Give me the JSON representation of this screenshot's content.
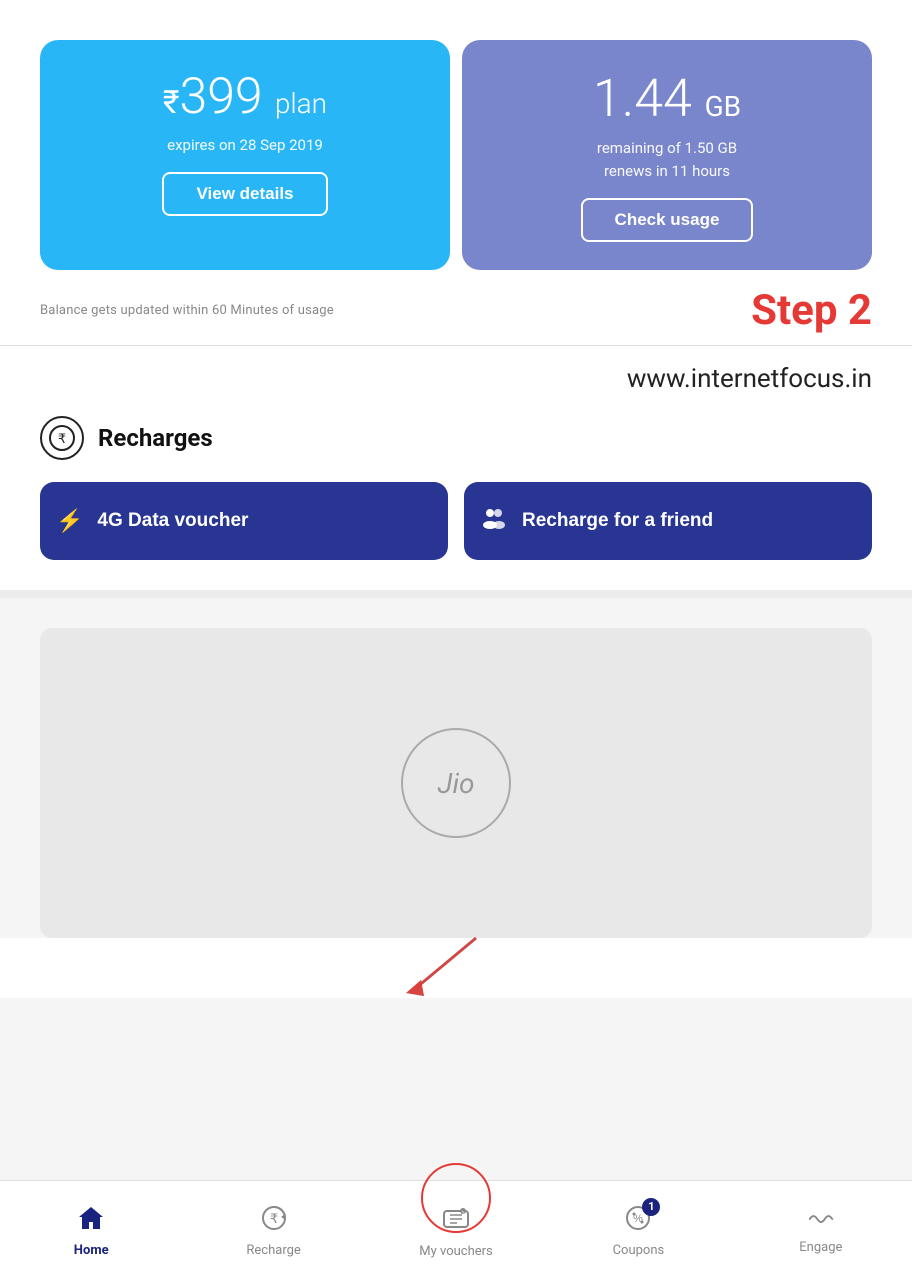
{
  "plan_card": {
    "rupee": "₹",
    "amount": "399",
    "plan_word": "plan",
    "expires": "expires on 28 Sep 2019",
    "btn_label": "View details"
  },
  "data_card": {
    "amount": "1.44",
    "unit": "GB",
    "info_line1": "remaining of 1.50 GB",
    "info_line2": "renews in 11 hours",
    "btn_label": "Check usage"
  },
  "balance_notice": "Balance gets updated within 60 Minutes of usage",
  "step_label": "Step 2",
  "website": "www.internetfocus.in",
  "recharges": {
    "title": "Recharges",
    "btn1": "4G Data voucher",
    "btn2": "Recharge for a friend"
  },
  "nav": {
    "home": "Home",
    "recharge": "Recharge",
    "my_vouchers": "My vouchers",
    "coupons": "Coupons",
    "engage": "Engage",
    "badge_count": "1"
  }
}
